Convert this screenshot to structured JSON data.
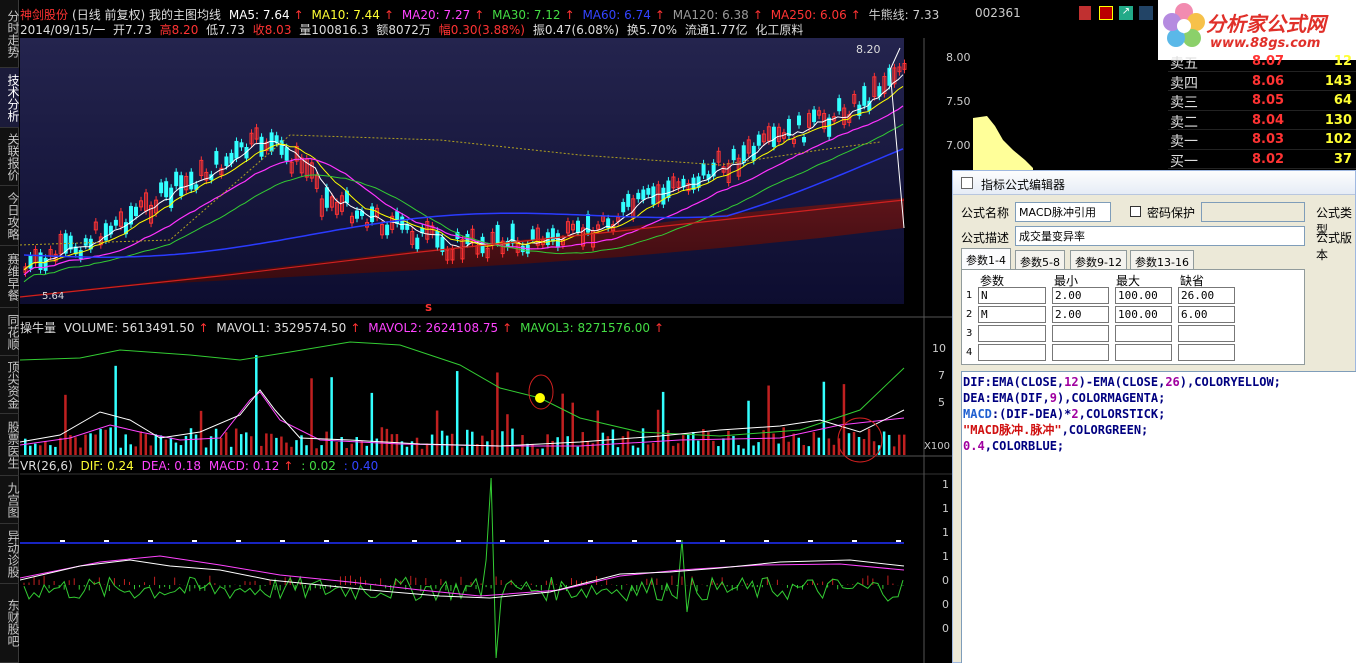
{
  "nav": {
    "items": [
      {
        "label": "分时走势"
      },
      {
        "label": "技术分析"
      },
      {
        "label": "关联报价"
      },
      {
        "label": "今日攻略"
      },
      {
        "label": "赛维早餐"
      },
      {
        "label": "同花顺"
      },
      {
        "label": "顶尖资金"
      },
      {
        "label": "股票医生"
      },
      {
        "label": "九宫图"
      },
      {
        "label": "异动诊股"
      },
      {
        "label": "东财股吧"
      }
    ]
  },
  "main_chart": {
    "header1": {
      "stock": "神剑股份",
      "mode": "(日线 前复权) 我的主图均线",
      "ma5": "MA5: 7.64",
      "ma10": "MA10: 7.44",
      "ma20": "MA20: 7.27",
      "ma30": "MA30: 7.12",
      "ma60": "MA60: 6.74",
      "ma120": "MA120: 6.38",
      "ma250": "MA250: 6.06",
      "bull": "牛熊线: 7.33"
    },
    "header2": {
      "date": "2014/09/15/一",
      "open": "开7.73",
      "high": "高8.20",
      "low": "低7.73",
      "close": "收8.03",
      "vol": "量100816.3",
      "amount": "额8072万",
      "chg": "幅0.30(3.88%)",
      "amp": "振0.47(6.08%)",
      "turnover": "换5.70%",
      "float": "流通1.77亿",
      "sector": "化工原料"
    },
    "peak_label": "8.20",
    "low_label": "5.64",
    "marker": "S",
    "y_ticks": [
      "8.00",
      "7.50",
      "7.00"
    ]
  },
  "volume_chart": {
    "header": {
      "name": "操牛量",
      "volume": "VOLUME: 5613491.50",
      "mavol1": "MAVOL1: 3529574.50",
      "mavol2": "MAVOL2: 2624108.75",
      "mavol3": "MAVOL3: 8271576.00"
    },
    "y_ticks": [
      "10",
      "7",
      "5"
    ],
    "unit": "X100"
  },
  "macd_chart": {
    "header": {
      "name": "VR(26,6)",
      "dif": "DIF: 0.24",
      "dea": "DEA: 0.18",
      "macd": "MACD: 0.12",
      "pulse": ": 0.02",
      "blue": ": 0.40"
    },
    "y_ticks": [
      "1",
      "1",
      "1",
      "1",
      "0",
      "0",
      "0"
    ]
  },
  "quote": {
    "code": "002361",
    "logo_text": "分析家公式网",
    "logo_url": "www.88gs.com",
    "rows": [
      {
        "label": "卖五",
        "price": "8.07",
        "vol": "12"
      },
      {
        "label": "卖四",
        "price": "8.06",
        "vol": "143"
      },
      {
        "label": "卖三",
        "price": "8.05",
        "vol": "64"
      },
      {
        "label": "卖二",
        "price": "8.04",
        "vol": "130"
      },
      {
        "label": "卖一",
        "price": "8.03",
        "vol": "102"
      },
      {
        "label": "买一",
        "price": "8.02",
        "vol": "37"
      }
    ]
  },
  "dialog": {
    "title": "指标公式编辑器",
    "name_label": "公式名称",
    "name_value": "MACD脉冲引用",
    "password_label": "密码保护",
    "type_label": "公式类型",
    "desc_label": "公式描述",
    "desc_value": "成交量变异率",
    "version_label": "公式版本",
    "tabs": [
      "参数1-4",
      "参数5-8",
      "参数9-12",
      "参数13-16"
    ],
    "grid_headers": [
      "参数",
      "最小",
      "最大",
      "缺省"
    ],
    "params": [
      {
        "idx": "1",
        "name": "N",
        "min": "2.00",
        "max": "100.00",
        "def": "26.00"
      },
      {
        "idx": "2",
        "name": "M",
        "min": "2.00",
        "max": "100.00",
        "def": "6.00"
      },
      {
        "idx": "3",
        "name": "",
        "min": "",
        "max": "",
        "def": ""
      },
      {
        "idx": "4",
        "name": "",
        "min": "",
        "max": "",
        "def": ""
      }
    ],
    "code_lines": [
      "DIF:EMA(CLOSE,12)-EMA(CLOSE,26),COLORYELLOW;",
      "DEA:EMA(DIF,9),COLORMAGENTA;",
      "MACD:(DIF-DEA)*2,COLORSTICK;",
      "\"MACD脉冲.脉冲\",COLORGREEN;",
      "0.4,COLORBLUE;"
    ]
  },
  "colors": {
    "up": "#ff3333",
    "down": "#33ffff",
    "ma5": "#ffffff",
    "ma10": "#ffff00",
    "ma20": "#ff33ff",
    "ma30": "#33cc33",
    "ma60": "#2a3bff",
    "ma250": "#d02020"
  }
}
